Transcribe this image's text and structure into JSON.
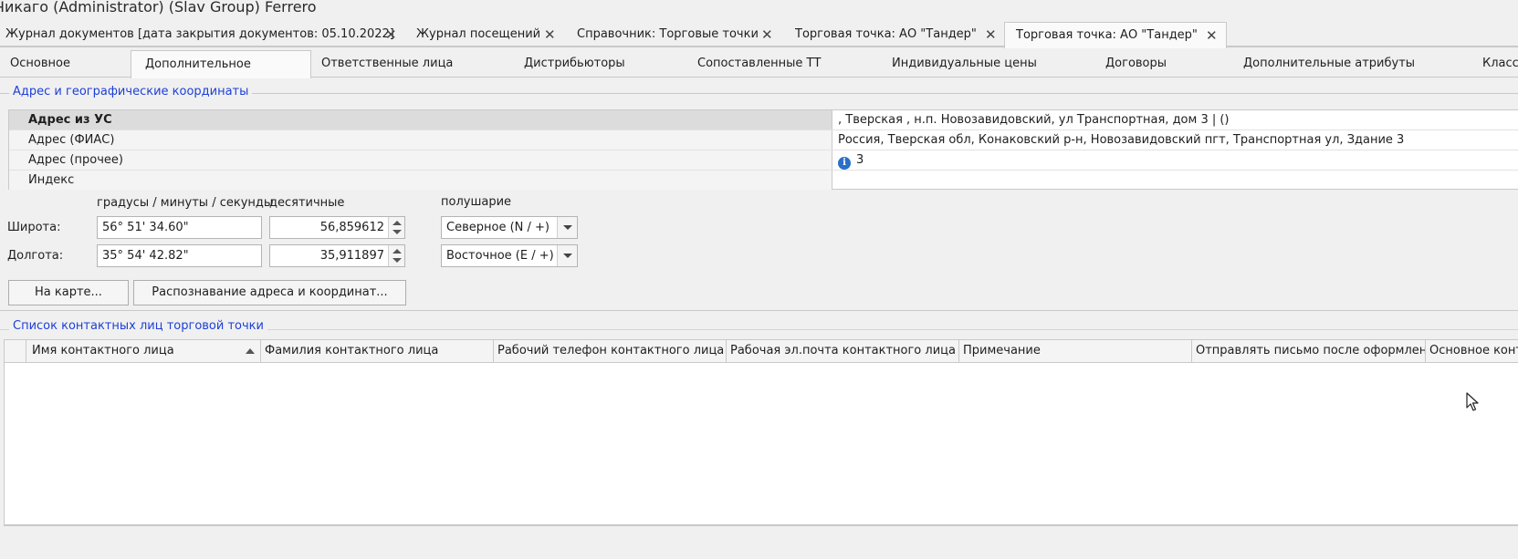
{
  "window": {
    "title": "Чикаго (Administrator) (Slav Group) Ferrero"
  },
  "doc_tabs": [
    {
      "label": "Журнал документов [дата закрытия документов: 05.10.2022]"
    },
    {
      "label": "Журнал посещений"
    },
    {
      "label": "Справочник: Торговые точки"
    },
    {
      "label": "Торговая точка:  АО \"Тандер\""
    },
    {
      "label": "Торговая точка:  АО \"Тандер\""
    }
  ],
  "close_glyph": "✕",
  "sub_tabs": [
    {
      "label": "Основное"
    },
    {
      "label": "Дополнительное"
    },
    {
      "label": "Ответственные лица"
    },
    {
      "label": "Дистрибьюторы"
    },
    {
      "label": "Сопоставленные ТТ"
    },
    {
      "label": "Индивидуальные цены"
    },
    {
      "label": "Договоры"
    },
    {
      "label": "Дополнительные атрибуты"
    },
    {
      "label": "Класси"
    }
  ],
  "address_group": {
    "title": "Адрес и географические координаты",
    "rows": [
      {
        "label": "Адрес из УС",
        "value": ", Тверская , н.п. Новозавидовский, ул Транспортная, дом 3 | ()"
      },
      {
        "label": "Адрес (ФИАС)",
        "value": "Россия, Тверская обл, Конаковский р-н, Новозавидовский пгт, Транспортная ул, Здание 3"
      },
      {
        "label": "Адрес (прочее)",
        "value": "3"
      },
      {
        "label": "Индекс",
        "value": ""
      }
    ]
  },
  "coords": {
    "dms_header": "градусы / минуты / секунды",
    "decimal_header": "десятичные",
    "hemisphere_header": "полушарие",
    "latitude": {
      "label": "Широта:",
      "dms": "56° 51' 34.60\"",
      "decimal": "56,859612",
      "hemisphere": "Северное (N / +)"
    },
    "longitude": {
      "label": "Долгота:",
      "dms": "35° 54' 42.82\"",
      "decimal": "35,911897",
      "hemisphere": "Восточное (E / +)"
    },
    "map_button": "На карте...",
    "recognize_button": "Распознавание адреса и координат..."
  },
  "contacts_group": {
    "title": "Список контактных лиц торговой точки",
    "columns": [
      "Имя контактного лица",
      "Фамилия контактного лица",
      "Рабочий телефон контактного лица",
      "Рабочая эл.почта контактного лица",
      "Примечание",
      "Отправлять письмо после оформлен...",
      "Основное конта"
    ]
  }
}
